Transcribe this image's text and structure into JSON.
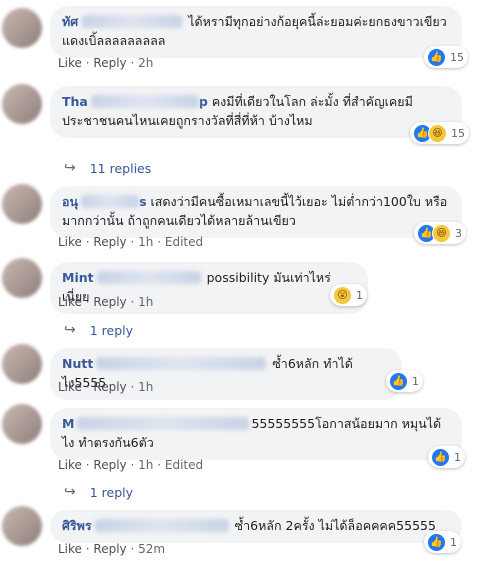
{
  "actions": {
    "like": "Like",
    "reply": "Reply",
    "sep": "·"
  },
  "comments": [
    {
      "author": "ทัศ",
      "text": "ได้หรามีทุกอย่างก้อยุคนี้ล่ะยอมค่ะยกธงขาวเขียว แดงเบิ้ลลลลลลลลล",
      "reaction_count": "15",
      "time": "2h",
      "edited": ""
    },
    {
      "author": "Tha",
      "author_tail": "p",
      "text": "คงมีที่เดียวในโลก ล่ะมั้ง ที่สำคัญเคยมีประชาชนคนไหนเคยถูกรางวัลที่สี่ที่ห้า บ้างไหม",
      "reaction_count": "15",
      "time": "",
      "edited": ""
    },
    {
      "author": "อนุ",
      "author_tail": "s",
      "text": "เสดงว่ามีคนซื้อเหมาเลขนี้ไว้เยอะ ไม่ต่ำกว่า100ใบ หรือมากกว่านั้น ถ้าถูกคนเดียวได้หลายล้านเขียว",
      "reaction_count": "3",
      "time": "1h",
      "edited": "Edited"
    },
    {
      "author": "Mint",
      "text": "possibility มันเท่าไหร่เนี่ยย",
      "reaction_count": "1",
      "time": "1h",
      "edited": ""
    },
    {
      "author": "Nutt",
      "text": "ซ้ำ6หลัก ทำได้ไง5555",
      "reaction_count": "1",
      "time": "1h",
      "edited": ""
    },
    {
      "author": "M",
      "text": "55555555โอกาสน้อยมาก หมุนได้ไง ทำตรงกัน6ตัว",
      "reaction_count": "1",
      "time": "1h",
      "edited": "Edited"
    },
    {
      "author": "ศิริพร",
      "text": "ซ้ำ6หลัก 2ครั้ง ไม่ได้ล็อคคคค55555",
      "reaction_count": "1",
      "time": "52m",
      "edited": ""
    }
  ],
  "replies": [
    {
      "label": "11 replies"
    },
    {
      "label": "1 reply"
    },
    {
      "label": "1 reply"
    }
  ],
  "icons": {
    "like": "like-icon",
    "haha": "haha-icon",
    "wow": "wow-icon",
    "reply_arrow": "reply-arrow-icon"
  },
  "colors": {
    "link": "#385898",
    "like_blue": "#2078f4",
    "bubble": "#f2f3f5"
  }
}
